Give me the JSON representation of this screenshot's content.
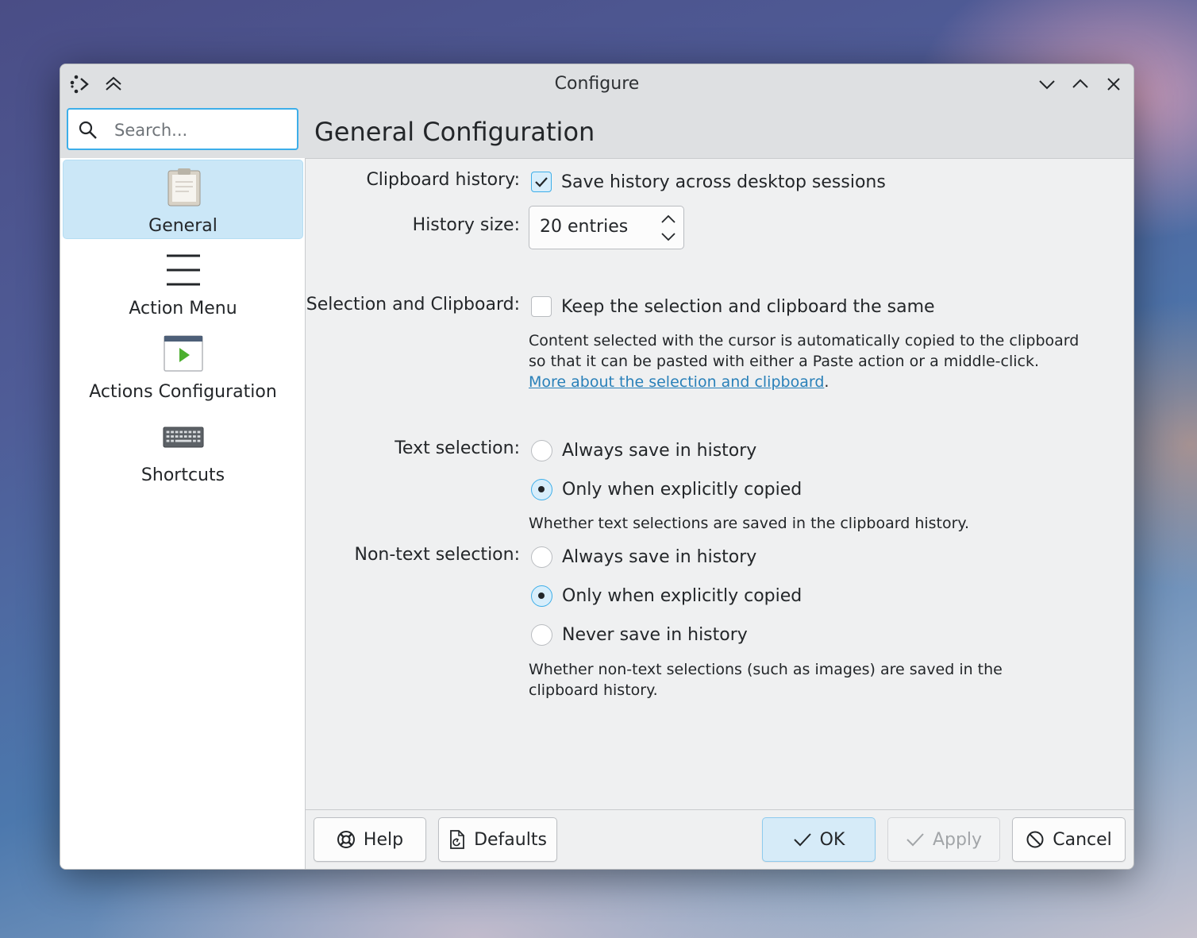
{
  "window": {
    "title": "Configure"
  },
  "search": {
    "placeholder": "Search..."
  },
  "sidebar": {
    "items": [
      {
        "label": "General",
        "icon": "clipboard-icon",
        "selected": true
      },
      {
        "label": "Action Menu",
        "icon": "hamburger-menu-icon",
        "selected": false
      },
      {
        "label": "Actions Configuration",
        "icon": "run-window-icon",
        "selected": false
      },
      {
        "label": "Shortcuts",
        "icon": "keyboard-icon",
        "selected": false
      }
    ]
  },
  "page": {
    "title": "General Configuration"
  },
  "form": {
    "clipboard_history": {
      "label": "Clipboard history:",
      "checkbox_label": "Save history across desktop sessions",
      "checked": true
    },
    "history_size": {
      "label": "History size:",
      "value": "20 entries"
    },
    "selection_clipboard": {
      "label": "Selection and Clipboard:",
      "checkbox_label": "Keep the selection and clipboard the same",
      "checked": false,
      "help_text": "Content selected with the cursor is automatically copied to the clipboard so that it can be pasted with either a Paste action or a middle-click.",
      "link_text": "More about the selection and clipboard",
      "link_suffix": "."
    },
    "text_selection": {
      "label": "Text selection:",
      "options": [
        "Always save in history",
        "Only when explicitly copied"
      ],
      "selected": "Only when explicitly copied",
      "help_text": "Whether text selections are saved in the clipboard history."
    },
    "non_text_selection": {
      "label": "Non-text selection:",
      "options": [
        "Always save in history",
        "Only when explicitly copied",
        "Never save in history"
      ],
      "selected": "Only when explicitly copied",
      "help_text": "Whether non-text selections (such as images) are saved in the clipboard history."
    }
  },
  "buttons": {
    "help": "Help",
    "defaults": "Defaults",
    "ok": "OK",
    "apply": "Apply",
    "cancel": "Cancel"
  },
  "colors": {
    "accent": "#3daee9",
    "selection_bg": "#cbe7f7",
    "link": "#2980b9",
    "window_bg": "#eff0f1"
  }
}
